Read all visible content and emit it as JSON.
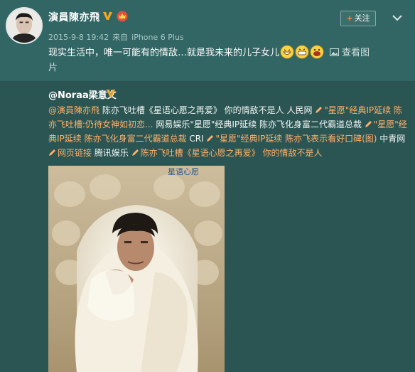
{
  "post": {
    "username": "演員陳亦飛",
    "timestamp": "2015-9-8 19:42",
    "source_prefix": "来自",
    "source": "iPhone 6 Plus",
    "follow_label": "关注",
    "text": "现实生活中，唯一可能有的情敌…就是我未来的儿子女儿",
    "view_image_label_1": "查看图",
    "view_image_label_2": "片"
  },
  "repost": {
    "author": "@Noraa梁意文",
    "mention": "@演員陳亦飛",
    "text_1": " 陈亦飞吐槽《星语心愿之再爱》 你的情敌不是人 人民网 ",
    "link_1": "\"星愿\"经典IP延续 陈",
    "link_1b": "亦飞吐槽:仍待女神如初恋...",
    "text_2": " 网易娱乐\"星愿\"经典IP延续 陈亦飞化身富二代霸道总裁 ",
    "link_2": "\"星愿\"经",
    "link_2b": "典IP延续 陈亦飞化身富二代霸道总裁",
    "text_3": " CRI ",
    "link_3": "\"星愿\"经典IP延续 陈亦飞表示看好口碑(图)",
    "text_4": " 中青网",
    "link_4": "网页链接",
    "text_5": " 腾讯娱乐 ",
    "link_5": "陈亦飞吐槽《星语心愿之再爱》 你的情敌不是人",
    "photo_caption": "星语心愿"
  },
  "colors": {
    "background": "#2f5a58",
    "link": "#ffb06a",
    "accent_plus": "#ff8d2a",
    "verified_badge": "#f5a623"
  },
  "icons": [
    "verified-v-icon",
    "vip-crown-icon",
    "menu-chevron-icon",
    "grin-emoji-icon",
    "picture-icon",
    "link-pen-icon"
  ]
}
